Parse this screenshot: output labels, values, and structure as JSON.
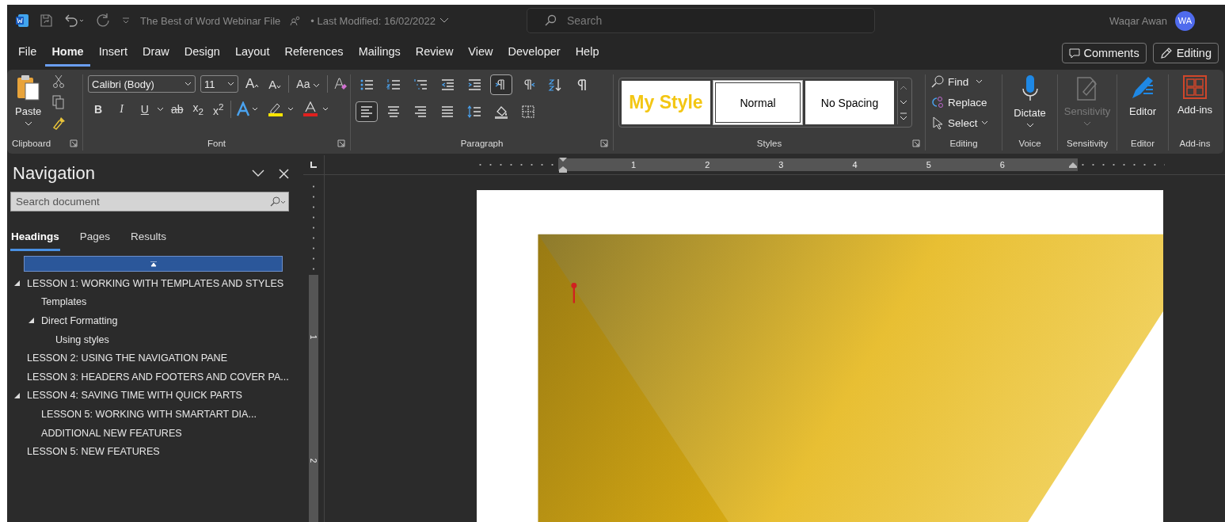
{
  "title_bar": {
    "title": "The Best of Word Webinar File",
    "last_modified": "• Last Modified: 16/02/2022",
    "search_placeholder": "Search",
    "user_name": "Waqar Awan",
    "user_initials": "WA"
  },
  "menu_tabs": [
    {
      "label": "File",
      "selected": false
    },
    {
      "label": "Home",
      "selected": true
    },
    {
      "label": "Insert",
      "selected": false
    },
    {
      "label": "Draw",
      "selected": false
    },
    {
      "label": "Design",
      "selected": false
    },
    {
      "label": "Layout",
      "selected": false
    },
    {
      "label": "References",
      "selected": false
    },
    {
      "label": "Mailings",
      "selected": false
    },
    {
      "label": "Review",
      "selected": false
    },
    {
      "label": "View",
      "selected": false
    },
    {
      "label": "Developer",
      "selected": false
    },
    {
      "label": "Help",
      "selected": false
    }
  ],
  "comments_button": "Comments",
  "editing_button": "Editing",
  "clipboard": {
    "paste": "Paste",
    "label": "Clipboard"
  },
  "font": {
    "name": "Calibri (Body)",
    "size": "11",
    "grow": "A",
    "shrink": "A",
    "change_case": "Aa",
    "bold": "B",
    "italic": "I",
    "underline": "U",
    "strikethrough": "ab",
    "subscript": "x$_{2}$",
    "superscript": "x$^{2}$",
    "label": "Font"
  },
  "paragraph": {
    "label": "Paragraph",
    "row_1": [
      {
        "kind": "bullets",
        "selected": false
      },
      {
        "kind": "numbering",
        "selected": false
      },
      {
        "kind": "multilevel",
        "selected": false
      },
      {
        "kind": "outdent",
        "selected": false
      },
      {
        "kind": "indent",
        "selected": false
      },
      {
        "kind": "ltr",
        "selected": true
      },
      {
        "kind": "rtl",
        "selected": false
      },
      {
        "kind": "sort",
        "selected": false
      },
      {
        "kind": "marks",
        "selected": false
      }
    ],
    "row_2": [
      {
        "kind": "align-left",
        "selected": true
      },
      {
        "kind": "align-center",
        "selected": false
      },
      {
        "kind": "align-right",
        "selected": false
      },
      {
        "kind": "justify",
        "selected": false
      },
      {
        "kind": "line-spacing",
        "selected": false
      },
      {
        "kind": "shading",
        "selected": false
      },
      {
        "kind": "borders",
        "selected": false
      }
    ]
  },
  "styles": {
    "label": "Styles",
    "items": [
      {
        "label": "My Style",
        "kind": "title",
        "selected": false
      },
      {
        "label": "Normal",
        "kind": "body",
        "selected": true
      },
      {
        "label": "No Spacing",
        "kind": "body",
        "selected": false
      }
    ]
  },
  "editing": {
    "find": "Find",
    "replace": "Replace",
    "select": "Select",
    "label": "Editing"
  },
  "voice": {
    "button": "Dictate",
    "label": "Voice"
  },
  "sensitivity": {
    "button": "Sensitivity",
    "label": "Sensitivity",
    "disabled": true
  },
  "editor": {
    "button": "Editor",
    "label": "Editor"
  },
  "addins": {
    "button": "Add-ins",
    "label": "Add-ins"
  },
  "navigation": {
    "title": "Navigation",
    "search_placeholder": "Search document",
    "tabs": [
      {
        "label": "Headings",
        "selected": true
      },
      {
        "label": "Pages",
        "selected": false
      },
      {
        "label": "Results",
        "selected": false
      }
    ],
    "headings": [
      {
        "label": "LESSON 1: WORKING WITH TEMPLATES AND STYLES",
        "expanded": true,
        "children": [
          {
            "label": "Templates"
          },
          {
            "label": "Direct Formatting",
            "expanded": true,
            "children": [
              {
                "label": "Using styles"
              }
            ]
          }
        ]
      },
      {
        "label": "LESSON 2: USING THE NAVIGATION PANE"
      },
      {
        "label": "LESSON 3: HEADERS AND FOOTERS AND COVER PA..."
      },
      {
        "label": "LESSON 4: SAVING TIME WITH QUICK PARTS",
        "expanded": true,
        "children": [
          {
            "label": "LESSON 5: WORKING WITH SMARTART DIA..."
          },
          {
            "label": "ADDITIONAL NEW FEATURES"
          }
        ]
      },
      {
        "label": "LESSON 5: NEW FEATURES"
      }
    ]
  },
  "ruler": {
    "numbers": [
      "1",
      "2",
      "3",
      "4",
      "5",
      "6"
    ],
    "vertical_numbers": [
      "1",
      "2"
    ]
  }
}
